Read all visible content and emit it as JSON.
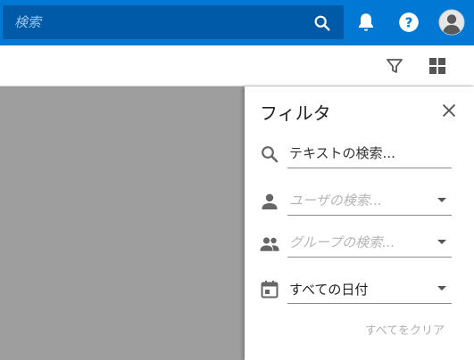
{
  "topbar": {
    "search": {
      "placeholder": "検索"
    },
    "icons": [
      "search-icon",
      "bell-icon",
      "help-icon",
      "avatar-icon"
    ]
  },
  "toolbar": {
    "icons": [
      "filter-icon",
      "grid-view-icon"
    ]
  },
  "filter_panel": {
    "title": "フィルタ",
    "text_search": {
      "placeholder": "テキストの検索..."
    },
    "user_search": {
      "placeholder": "ユーザの検索..."
    },
    "group_search": {
      "placeholder": "グループの検索..."
    },
    "date": {
      "value": "すべての日付"
    },
    "clear_all": "すべてをクリア"
  },
  "colors": {
    "topbar": "#0078d4",
    "search_box": "#005aa8",
    "backdrop": "#9e9e9e"
  }
}
